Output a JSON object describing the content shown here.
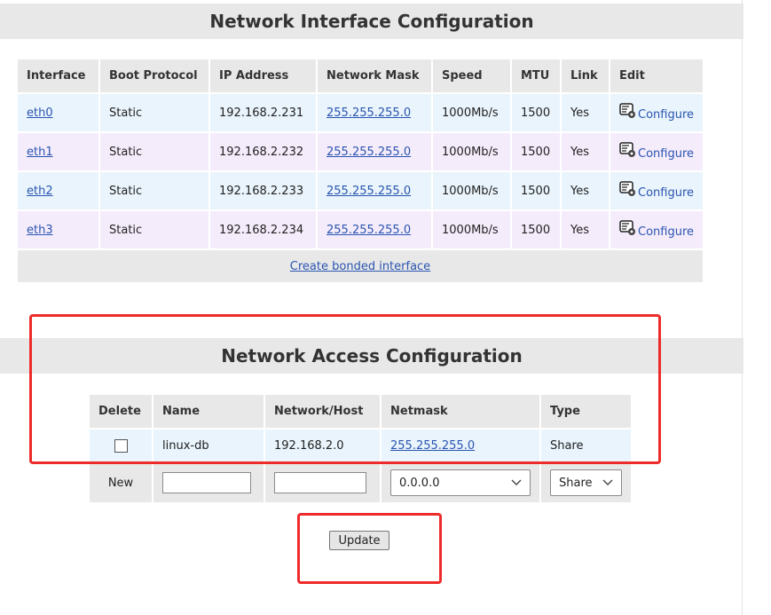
{
  "interface_section": {
    "title": "Network Interface Configuration",
    "headers": [
      "Interface",
      "Boot Protocol",
      "IP Address",
      "Network Mask",
      "Speed",
      "MTU",
      "Link",
      "Edit"
    ],
    "rows": [
      {
        "interface": "eth0",
        "boot": "Static",
        "ip": "192.168.2.231",
        "mask": "255.255.255.0",
        "speed": "1000Mb/s",
        "mtu": "1500",
        "link": "Yes",
        "edit": "Configure"
      },
      {
        "interface": "eth1",
        "boot": "Static",
        "ip": "192.168.2.232",
        "mask": "255.255.255.0",
        "speed": "1000Mb/s",
        "mtu": "1500",
        "link": "Yes",
        "edit": "Configure"
      },
      {
        "interface": "eth2",
        "boot": "Static",
        "ip": "192.168.2.233",
        "mask": "255.255.255.0",
        "speed": "1000Mb/s",
        "mtu": "1500",
        "link": "Yes",
        "edit": "Configure"
      },
      {
        "interface": "eth3",
        "boot": "Static",
        "ip": "192.168.2.234",
        "mask": "255.255.255.0",
        "speed": "1000Mb/s",
        "mtu": "1500",
        "link": "Yes",
        "edit": "Configure"
      }
    ],
    "create_bonded_label": "Create bonded interface"
  },
  "access_section": {
    "title": "Network Access Configuration",
    "headers": [
      "Delete",
      "Name",
      "Network/Host",
      "Netmask",
      "Type"
    ],
    "rows": [
      {
        "delete": false,
        "name": "linux-db",
        "network": "192.168.2.0",
        "netmask": "255.255.255.0",
        "type": "Share"
      }
    ],
    "new_row": {
      "label": "New",
      "name_value": "",
      "network_value": "",
      "netmask_selected": "0.0.0.0",
      "type_selected": "Share"
    },
    "update_label": "Update"
  },
  "colors": {
    "header_bg": "#e8e8e8",
    "row_blue": "#e9f4fc",
    "row_purple": "#f5ecfb",
    "link": "#2a55b0",
    "highlight_red": "#ee2b2b"
  },
  "icons": {
    "configure": "configure-icon",
    "dropdown": "chevron-down-icon"
  }
}
